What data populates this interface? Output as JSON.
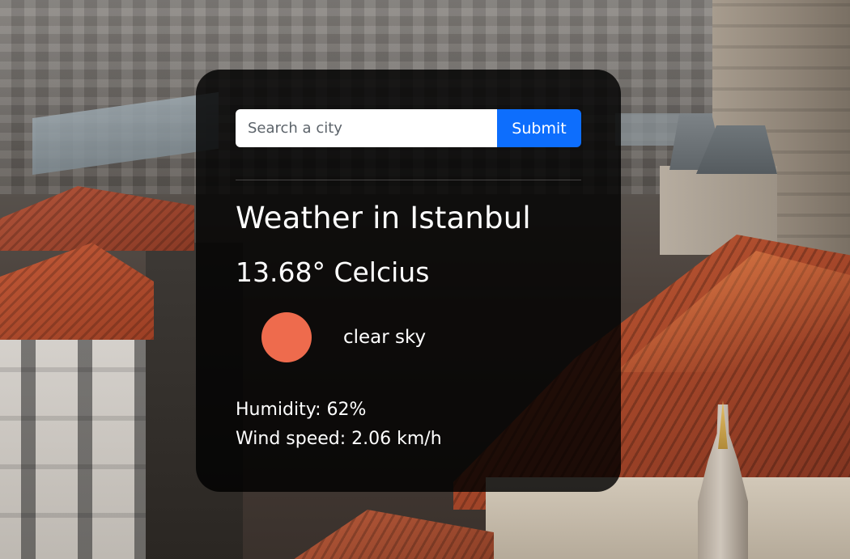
{
  "search": {
    "placeholder": "Search a city",
    "value": "",
    "submit_label": "Submit"
  },
  "weather": {
    "heading": "Weather in Istanbul",
    "temperature": "13.68° Celcius",
    "icon": "sun-icon",
    "icon_color": "#ee6b4d",
    "description": "clear sky",
    "humidity": "Humidity: 62%",
    "wind_speed": "Wind speed: 2.06 km/h"
  },
  "colors": {
    "card_background": "rgba(0, 0, 0, 0.82)",
    "accent": "#0d6efd",
    "text": "#ffffff"
  }
}
